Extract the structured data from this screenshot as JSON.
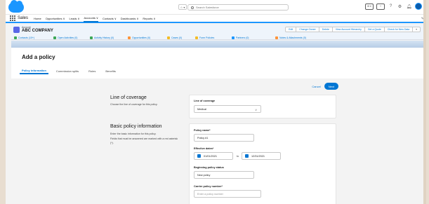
{
  "global_header": {
    "favorites_label": "☆ ▾",
    "search_placeholder": "Search Salesforce",
    "utility_icons": [
      "help-icon",
      "setup-icon",
      "notification-icon"
    ]
  },
  "app_nav": {
    "app_name": "Sales",
    "items": [
      "Home",
      "Opportunities ∨",
      "Leads ∨",
      "Accounts ∨",
      "Contacts ∨",
      "Dashboards ∨",
      "Reports ∨"
    ],
    "active_index": 3
  },
  "record": {
    "type_label": "Account",
    "name": "ABC COMPANY",
    "actions": [
      "Edit",
      "Change Owner",
      "Delete",
      "View Account Hierarchy",
      "Get a Quote",
      "Check for New Data"
    ],
    "related": [
      {
        "label": "Contacts (10+)",
        "color": "#3ba755"
      },
      {
        "label": "Open Activities (0)",
        "color": "#3ba755"
      },
      {
        "label": "Activity History (0)",
        "color": "#3ba755"
      },
      {
        "label": "Opportunities (0)",
        "color": "#fe9339"
      },
      {
        "label": "Cases (0)",
        "color": "#f4bc25"
      },
      {
        "label": "Form Policies",
        "color": "#f4bc25"
      },
      {
        "label": "Partners (0)",
        "color": "#1b96ff"
      },
      {
        "label": "Notes & Attachments (0)",
        "color": "#fe9339"
      }
    ]
  },
  "modal": {
    "title": "Add a policy",
    "tabs": [
      "Policy information",
      "Commission splits",
      "Roles",
      "Benefits"
    ],
    "active_tab": 0,
    "cancel_label": "Cancel",
    "next_label": "Next",
    "coverage_section": {
      "title": "Line of coverage",
      "description": "Choose the line of coverage for this policy.",
      "field_label": "Line of coverage",
      "value": "Medical"
    },
    "basic_section": {
      "title": "Basic policy information",
      "description_1": "Enter the basic information for this policy.",
      "description_2": "Fields that must be answered are marked with a red asterisk (*).",
      "policy_name_label": "Policy name*",
      "policy_name_value": "Policy #1",
      "effective_dates_label": "Effective dates*",
      "start_date": "01/01/2021",
      "to_label": "to",
      "end_date": "12/31/2021",
      "status_label": "Beginning policy status",
      "status_value": "New policy",
      "carrier_label": "Carrier policy number*",
      "carrier_placeholder": "Enter a policy number"
    }
  },
  "colors": {
    "brand_blue": "#0176d3",
    "salesforce_cloud": "#1b96ff",
    "account_icon": "#5867e8"
  }
}
